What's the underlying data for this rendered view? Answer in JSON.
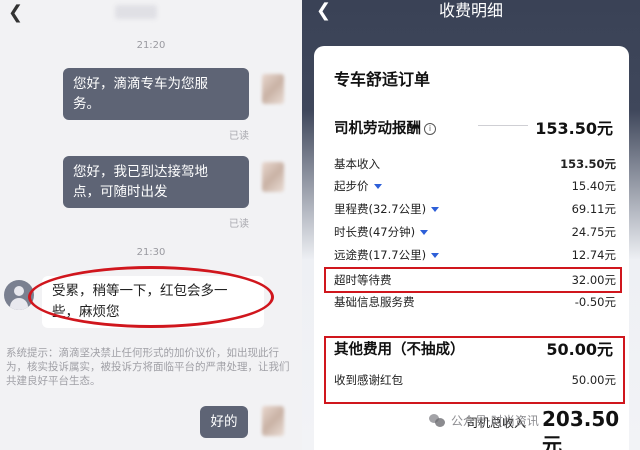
{
  "chat": {
    "back_icon": "back-arrow-icon",
    "messages": [
      {
        "time": "21:20"
      },
      {
        "text_line1": "您好，滴滴专车为您服",
        "text_line2": "务。",
        "status": "已读"
      },
      {
        "text_line1": "您好，我已到达接驾地",
        "text_line2": "点，可随时出发",
        "status": "已读"
      },
      {
        "time": "21:30"
      },
      {
        "text_line1": "受累，稍等一下，红包会多一",
        "text_line2": "些，麻烦您"
      },
      {
        "system_text": "系统提示：滴滴坚决禁止任何形式的加价议价，如出现此行为，核实投诉属实，被投诉方将面临平台的严肃处理，让我们共建良好平台生态。"
      },
      {
        "text": "好的"
      }
    ]
  },
  "fees": {
    "title": "收费明细",
    "order_type": "专车舒适订单",
    "labor_label": "司机劳动报酬",
    "labor_value": "153.50元",
    "rows": [
      {
        "label": "基本收入",
        "value": "153.50元"
      },
      {
        "label": "起步价",
        "value": "15.40元"
      },
      {
        "label": "里程费(32.7公里)",
        "value": "69.11元"
      },
      {
        "label": "时长费(47分钟)",
        "value": "24.75元"
      },
      {
        "label": "远途费(17.7公里)",
        "value": "12.74元"
      },
      {
        "label": "超时等待费",
        "value": "32.00元"
      },
      {
        "label": "基础信息服务费",
        "value": "-0.50元"
      }
    ],
    "other_label": "其他费用（不抽成）",
    "other_value": "50.00元",
    "tip_label": "收到感谢红包",
    "tip_value": "50.00元",
    "total_label": "司机总收入",
    "total_value": "203.50元",
    "watermark": "公众号·时尚资讯"
  },
  "colors": {
    "highlight": "#d0161d",
    "header_bg": "#3a4256",
    "bubble_out": "#5e6475"
  }
}
